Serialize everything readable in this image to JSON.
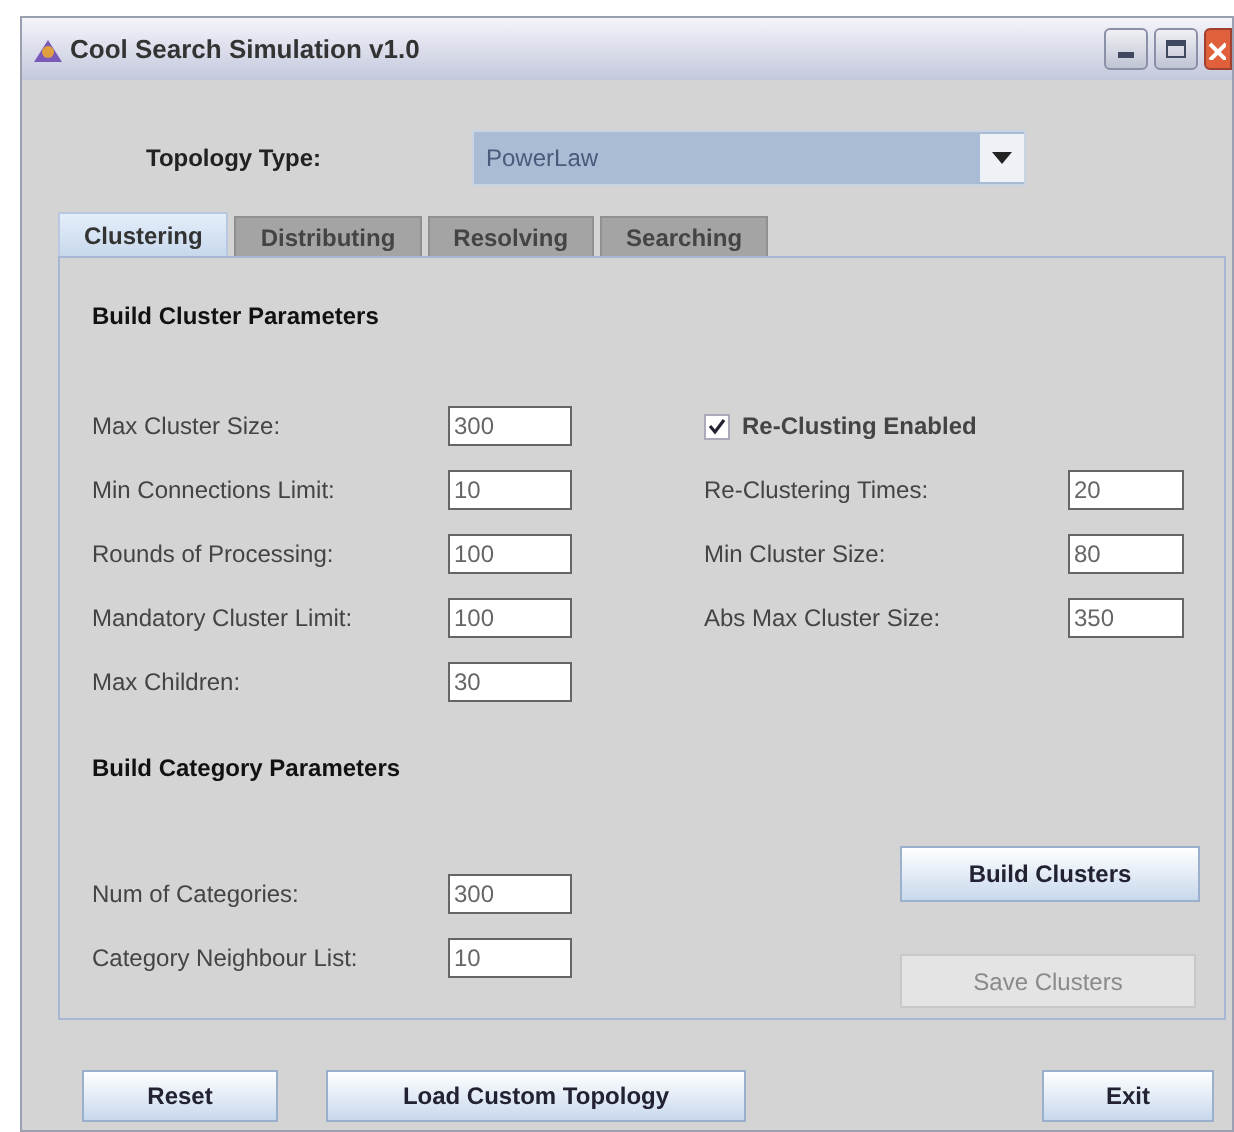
{
  "window": {
    "title": "Cool Search Simulation v1.0"
  },
  "topology": {
    "label": "Topology Type:",
    "value": "PowerLaw"
  },
  "tabs": [
    {
      "label": "Clustering",
      "selected": true
    },
    {
      "label": "Distributing",
      "selected": false
    },
    {
      "label": "Resolving",
      "selected": false
    },
    {
      "label": "Searching",
      "selected": false
    }
  ],
  "cluster_parameters": {
    "heading": "Build Cluster Parameters",
    "left_fields": [
      {
        "label": "Max Cluster Size:",
        "value": "300"
      },
      {
        "label": "Min Connections Limit:",
        "value": "10"
      },
      {
        "label": "Rounds of Processing:",
        "value": "100"
      },
      {
        "label": "Mandatory Cluster Limit:",
        "value": "100"
      },
      {
        "label": "Max Children:",
        "value": "30"
      }
    ],
    "reclustering": {
      "label": "Re-Clusting Enabled",
      "checked": true
    },
    "right_fields": [
      {
        "label": "Re-Clustering Times:",
        "value": "20"
      },
      {
        "label": "Min Cluster Size:",
        "value": "80"
      },
      {
        "label": "Abs Max Cluster Size:",
        "value": "350"
      }
    ]
  },
  "category_parameters": {
    "heading": "Build Category Parameters",
    "fields": [
      {
        "label": "Num of Categories:",
        "value": "300"
      },
      {
        "label": "Category Neighbour List:",
        "value": "10"
      }
    ],
    "buttons": [
      {
        "label": "Build Clusters",
        "disabled": false
      },
      {
        "label": "Save Clusters",
        "disabled": true
      }
    ]
  },
  "bottom_buttons": [
    {
      "label": "Reset"
    },
    {
      "label": "Load Custom Topology"
    },
    {
      "label": "Exit"
    }
  ]
}
